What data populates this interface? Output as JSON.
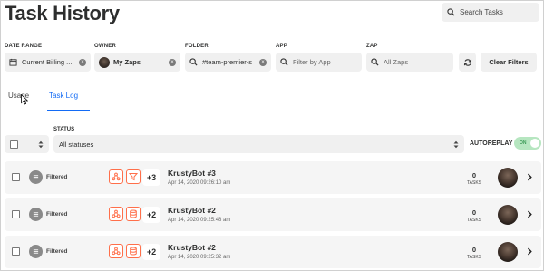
{
  "header": {
    "title": "Task History",
    "search_placeholder": "Search Tasks"
  },
  "filters": {
    "date_range": {
      "label": "DATE RANGE",
      "value": "Current Billing ..."
    },
    "owner": {
      "label": "OWNER",
      "value": "My Zaps"
    },
    "folder": {
      "label": "FOLDER",
      "value": "#team-premier-s"
    },
    "app": {
      "label": "APP",
      "placeholder": "Filter by App"
    },
    "zap": {
      "label": "ZAP",
      "placeholder": "All Zaps"
    },
    "clear_label": "Clear Filters"
  },
  "tabs": [
    {
      "label": "Usage"
    },
    {
      "label": "Task Log"
    }
  ],
  "active_tab": "Task Log",
  "status": {
    "label": "STATUS",
    "value": "All statuses"
  },
  "autoreplay": {
    "label": "AUTOREPLAY",
    "toggle_text": "ON",
    "on": true
  },
  "colors": {
    "accent": "#136bf5",
    "app_icon_border": "#ff6f4a",
    "toggle_bg": "#b6e6c0"
  },
  "rows": [
    {
      "status": "Filtered",
      "icons": [
        "webhook-icon",
        "filter-icon"
      ],
      "more": "+3",
      "zap_name": "KrustyBot #3",
      "date": "Apr 14, 2020 09:26:10 am",
      "tasks": "0",
      "tasks_label": "TASKS"
    },
    {
      "status": "Filtered",
      "icons": [
        "webhook-icon",
        "storage-icon"
      ],
      "more": "+2",
      "zap_name": "KrustyBot #2",
      "date": "Apr 14, 2020 09:25:48 am",
      "tasks": "0",
      "tasks_label": "TASKS"
    },
    {
      "status": "Filtered",
      "icons": [
        "webhook-icon",
        "storage-icon"
      ],
      "more": "+2",
      "zap_name": "KrustyBot #2",
      "date": "Apr 14, 2020 09:25:32 am",
      "tasks": "0",
      "tasks_label": "TASKS"
    }
  ]
}
